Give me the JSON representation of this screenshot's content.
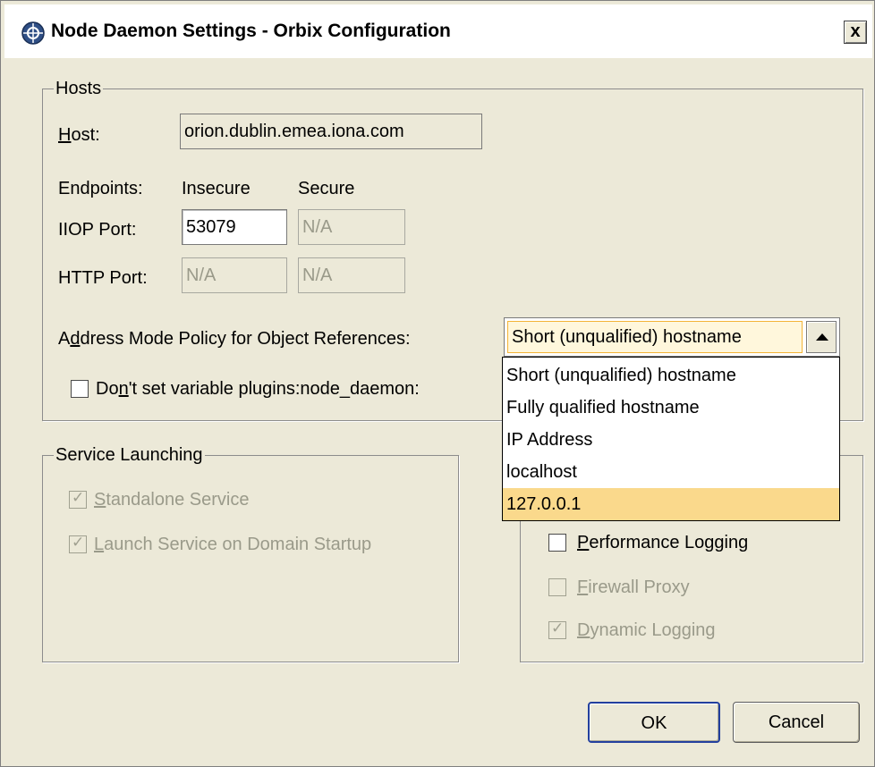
{
  "window": {
    "title": "Node Daemon Settings - Orbix Configuration",
    "close_label": "x"
  },
  "hosts": {
    "group_label": "Hosts",
    "host_label_mnemonic": "H",
    "host_label_rest": "ost:",
    "host_value": "orion.dublin.emea.iona.com",
    "endpoints_label": "Endpoints:",
    "insecure_label": "Insecure",
    "secure_label": "Secure",
    "iiop_label": "IIOP Port:",
    "iiop_insecure": "53079",
    "iiop_secure": "N/A",
    "http_label": "HTTP Port:",
    "http_insecure": "N/A",
    "http_secure": "N/A",
    "address_label_pre": "A",
    "address_label_mnemonic": "d",
    "address_label_rest": "dress Mode Policy for Object References:",
    "address_selected": "Short (unqualified) hostname",
    "address_options": [
      "Short (unqualified) hostname",
      "Fully qualified hostname",
      "IP Address",
      "localhost",
      "127.0.0.1"
    ],
    "address_highlighted_index": 4,
    "dont_set_pre": "Do",
    "dont_set_mnemonic": "n",
    "dont_set_rest": "'t set variable plugins:node_daemon:",
    "dont_set_checked": false
  },
  "service_launching": {
    "group_label": "Service Launching",
    "standalone_pre": "",
    "standalone_mnemonic": "S",
    "standalone_rest": "tandalone Service",
    "standalone_checked": true,
    "launch_pre": "",
    "launch_mnemonic": "L",
    "launch_rest": "aunch Service on Domain Startup",
    "launch_checked": true
  },
  "options": {
    "perf_mnemonic": "P",
    "perf_rest": "erformance Logging",
    "perf_checked": false,
    "firewall_mnemonic": "F",
    "firewall_rest": "irewall Proxy",
    "firewall_checked": false,
    "dynamic_mnemonic": "D",
    "dynamic_rest": "ynamic Logging",
    "dynamic_checked": true
  },
  "buttons": {
    "ok": "OK",
    "cancel": "Cancel"
  },
  "colors": {
    "dialog_bg": "#ece9d8",
    "selection_highlight": "#fad98c",
    "focus_border": "#f3b437"
  },
  "icons": {
    "app": "orbix-app-icon",
    "combo_arrow": "chevron-up-icon",
    "check": "check-icon"
  }
}
